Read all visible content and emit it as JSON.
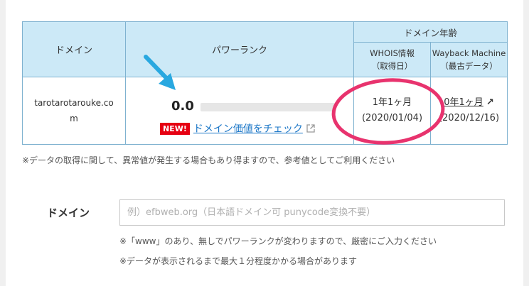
{
  "table": {
    "header": {
      "domain": "ドメイン",
      "power_rank": "パワーランク",
      "domain_age": "ドメイン年齢",
      "whois_line1": "WHOIS情報",
      "whois_line2": "（取得日）",
      "wayback_line1": "Wayback Machine",
      "wayback_line2": "（最古データ）"
    },
    "row": {
      "domain_line1": "tarotarotarouke.co",
      "domain_line2": "m",
      "rank_value": "0.0",
      "rank_fraction": 0.0,
      "new_badge": "NEW!",
      "check_link": "ドメイン価値をチェック",
      "whois_age": "1年1ヶ月",
      "whois_date": "(2020/01/04)",
      "wayback_age": "0年1ヶ月",
      "wayback_date": "(2020/12/16)"
    }
  },
  "note": "※データの取得に関して、異常値が発生する場合もあり得ますので、参考値としてご利用ください",
  "form": {
    "label": "ドメイン",
    "placeholder": "例）efbweb.org（日本語ドメイン可 punycode変換不要）",
    "value": "",
    "hint1": "※「www」のあり、無しでパワーランクが変わりますので、厳密にご入力ください",
    "hint2": "※データが表示されるまで最大１分程度かかる場合があります"
  },
  "colors": {
    "header_bg": "#cce9f7",
    "border": "#7fb2d0",
    "link": "#1c77c7",
    "badge": "#e60012",
    "annotation_circle": "#e8336e",
    "annotation_arrow": "#29a8e0"
  },
  "icons": {
    "external_link": "external-link-icon",
    "wayback_arrow": "arrow-up-right-icon"
  }
}
